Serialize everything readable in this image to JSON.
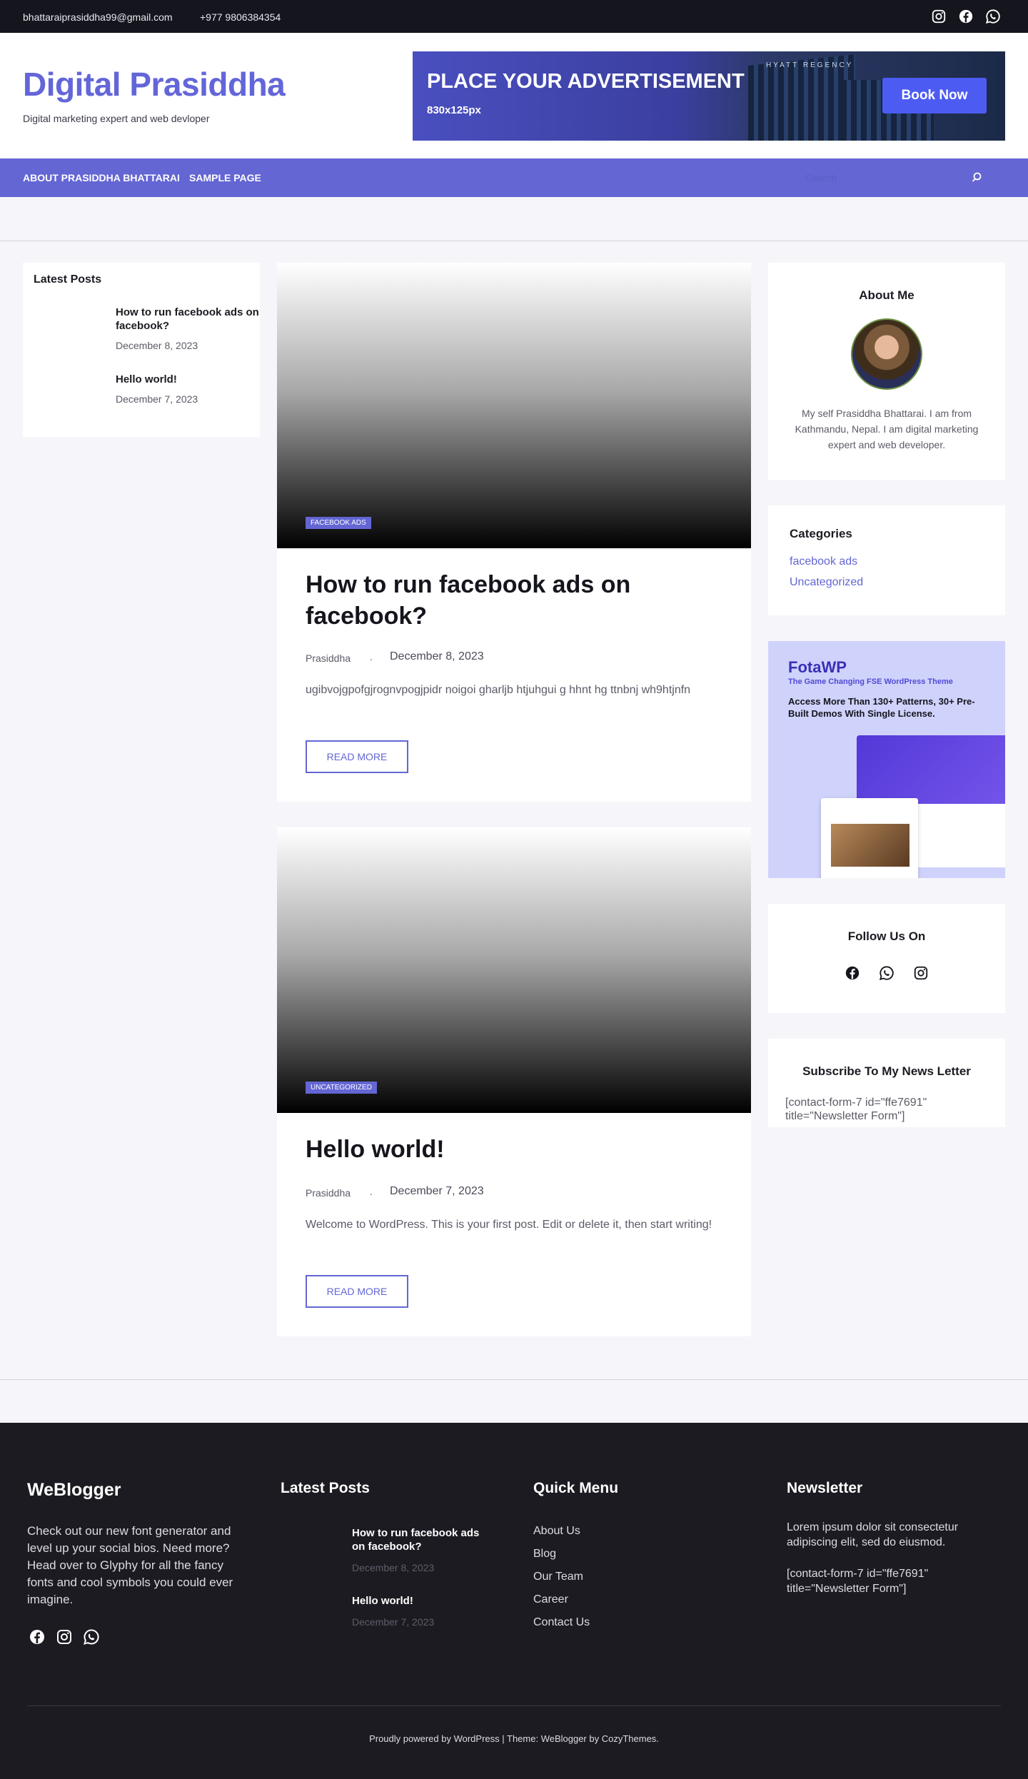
{
  "topbar": {
    "email": "bhattaraiprasiddha99@gmail.com",
    "phone": "+977 9806384354",
    "social_icons": [
      "instagram-icon",
      "facebook-icon",
      "whatsapp-icon"
    ]
  },
  "header": {
    "site_title": "Digital Prasiddha",
    "tagline": "Digital marketing expert and web devloper",
    "ad": {
      "title": "PLACE YOUR ADVERTISEMENT",
      "size": "830x125px",
      "button": "Book Now",
      "building_sign": "HYATT REGENCY"
    }
  },
  "nav": {
    "items": [
      "ABOUT PRASIDDHA BHATTARAI",
      "SAMPLE PAGE"
    ],
    "search_placeholder": "Search"
  },
  "left_sidebar": {
    "title": "Latest Posts",
    "posts": [
      {
        "title": "How to run facebook ads on facebook?",
        "date": "December 8, 2023"
      },
      {
        "title": "Hello world!",
        "date": "December 7, 2023"
      }
    ]
  },
  "posts": [
    {
      "category": "FACEBOOK ADS",
      "title": "How to run facebook ads on facebook?",
      "author": "Prasiddha",
      "separator": ".",
      "date": "December 8, 2023",
      "excerpt": "ugibvojgpofgjrognvpogjpidr noigoi  gharljb htjuhgui g hhnt   hg  ttnbnj wh9htjnfn",
      "read_more": "READ MORE"
    },
    {
      "category": "UNCATEGORIZED",
      "title": "Hello world!",
      "author": "Prasiddha",
      "separator": ".",
      "date": "December 7, 2023",
      "excerpt": "Welcome to WordPress. This is your first post. Edit or delete it, then start writing!",
      "read_more": "READ MORE"
    }
  ],
  "right_sidebar": {
    "about": {
      "title": "About Me",
      "text": "My self Prasiddha Bhattarai. I am from Kathmandu, Nepal. I am digital marketing expert and web developer."
    },
    "categories": {
      "title": "Categories",
      "items": [
        "facebook ads",
        "Uncategorized"
      ]
    },
    "promo": {
      "title": "FotaWP",
      "subtitle": "The Game Changing FSE WordPress Theme",
      "description": "Access More Than 130+ Patterns, 30+ Pre-Built Demos With Single License."
    },
    "follow": {
      "title": "Follow Us On",
      "icons": [
        "facebook-icon",
        "whatsapp-icon",
        "instagram-icon"
      ]
    },
    "newsletter": {
      "title": "Subscribe To My News Letter",
      "shortcode": "[contact-form-7 id=\"ffe7691\" title=\"Newsletter Form\"]"
    }
  },
  "footer": {
    "about": {
      "title": "WeBlogger",
      "text": "Check out our new font generator and level up your social bios. Need more? Head over to Glyphy for all the fancy fonts and cool symbols you could ever imagine.",
      "social_icons": [
        "facebook-icon",
        "instagram-icon",
        "whatsapp-icon"
      ]
    },
    "latest_posts": {
      "title": "Latest Posts",
      "posts": [
        {
          "title": "How to run facebook ads on facebook?",
          "date": "December 8, 2023"
        },
        {
          "title": "Hello world!",
          "date": "December 7, 2023"
        }
      ]
    },
    "quick_menu": {
      "title": "Quick Menu",
      "items": [
        "About Us",
        "Blog",
        "Our Team",
        "Career",
        "Contact Us"
      ]
    },
    "newsletter": {
      "title": "Newsletter",
      "text": "Lorem ipsum dolor sit consectetur adipiscing elit, sed do eiusmod.",
      "shortcode": "[contact-form-7 id=\"ffe7691\" title=\"Newsletter Form\"]"
    },
    "copyright": "Proudly powered by WordPress | Theme: WeBlogger by  CozyThemes."
  },
  "colors": {
    "accent": "#6366d3",
    "topbar_bg": "#15151d",
    "footer_bg": "#1c1b21",
    "page_bg": "#f6f6fa"
  }
}
